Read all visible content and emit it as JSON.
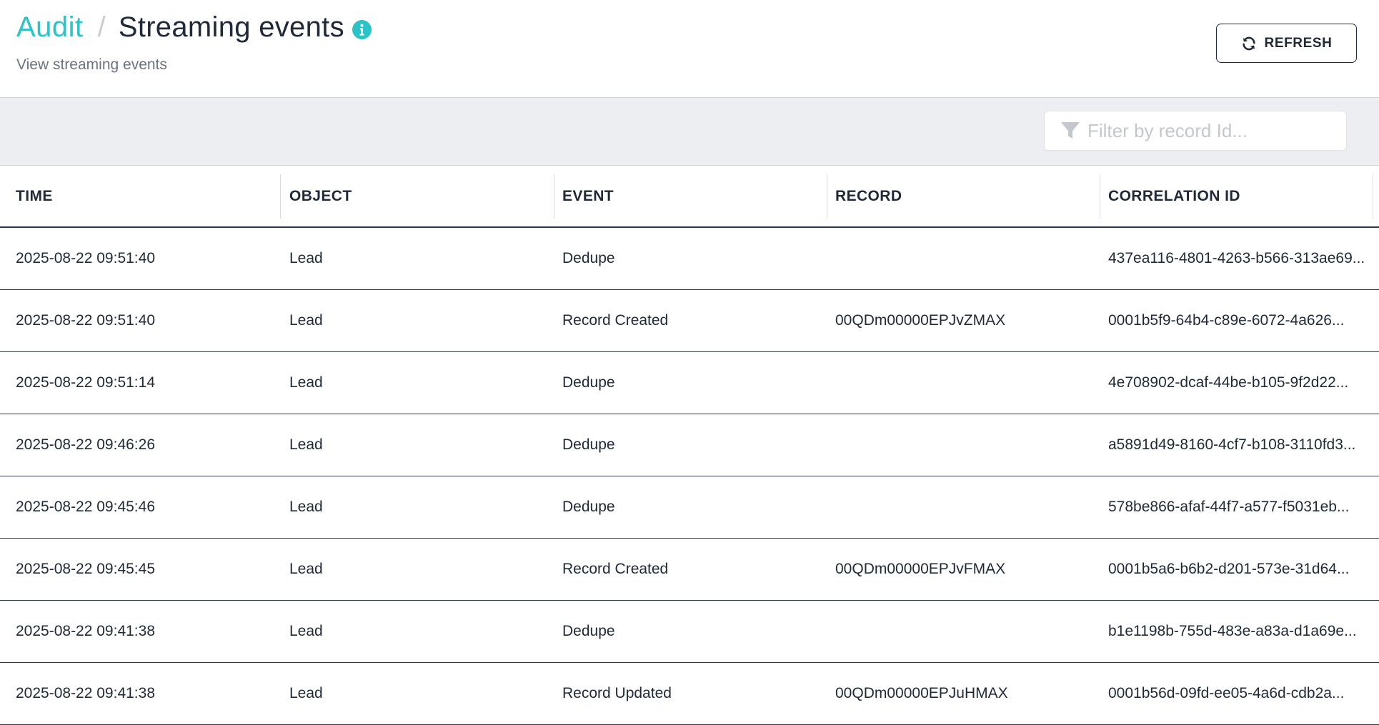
{
  "header": {
    "breadcrumb_root": "Audit",
    "breadcrumb_separator": "/",
    "title": "Streaming events",
    "subtitle": "View streaming events",
    "info_icon": "info-icon",
    "refresh_label": "REFRESH",
    "refresh_icon": "refresh-icon"
  },
  "filter": {
    "placeholder": "Filter by record Id...",
    "value": "",
    "icon": "filter-icon"
  },
  "colors": {
    "accent": "#29c3c8",
    "header_text": "#1f2937",
    "filter_bar_bg": "#eceef1"
  },
  "table": {
    "columns": [
      "TIME",
      "OBJECT",
      "EVENT",
      "RECORD",
      "CORRELATION ID"
    ],
    "rows": [
      {
        "time": "2025-08-22 09:51:40",
        "object": "Lead",
        "event": "Dedupe",
        "record": "",
        "correlation_id": "437ea116-4801-4263-b566-313ae69..."
      },
      {
        "time": "2025-08-22 09:51:40",
        "object": "Lead",
        "event": "Record Created",
        "record": "00QDm00000EPJvZMAX",
        "correlation_id": "0001b5f9-64b4-c89e-6072-4a626..."
      },
      {
        "time": "2025-08-22 09:51:14",
        "object": "Lead",
        "event": "Dedupe",
        "record": "",
        "correlation_id": "4e708902-dcaf-44be-b105-9f2d22..."
      },
      {
        "time": "2025-08-22 09:46:26",
        "object": "Lead",
        "event": "Dedupe",
        "record": "",
        "correlation_id": "a5891d49-8160-4cf7-b108-3110fd3..."
      },
      {
        "time": "2025-08-22 09:45:46",
        "object": "Lead",
        "event": "Dedupe",
        "record": "",
        "correlation_id": "578be866-afaf-44f7-a577-f5031eb..."
      },
      {
        "time": "2025-08-22 09:45:45",
        "object": "Lead",
        "event": "Record Created",
        "record": "00QDm00000EPJvFMAX",
        "correlation_id": "0001b5a6-b6b2-d201-573e-31d64..."
      },
      {
        "time": "2025-08-22 09:41:38",
        "object": "Lead",
        "event": "Dedupe",
        "record": "",
        "correlation_id": "b1e1198b-755d-483e-a83a-d1a69e..."
      },
      {
        "time": "2025-08-22 09:41:38",
        "object": "Lead",
        "event": "Record Updated",
        "record": "00QDm00000EPJuHMAX",
        "correlation_id": "0001b56d-09fd-ee05-4a6d-cdb2a..."
      }
    ]
  }
}
